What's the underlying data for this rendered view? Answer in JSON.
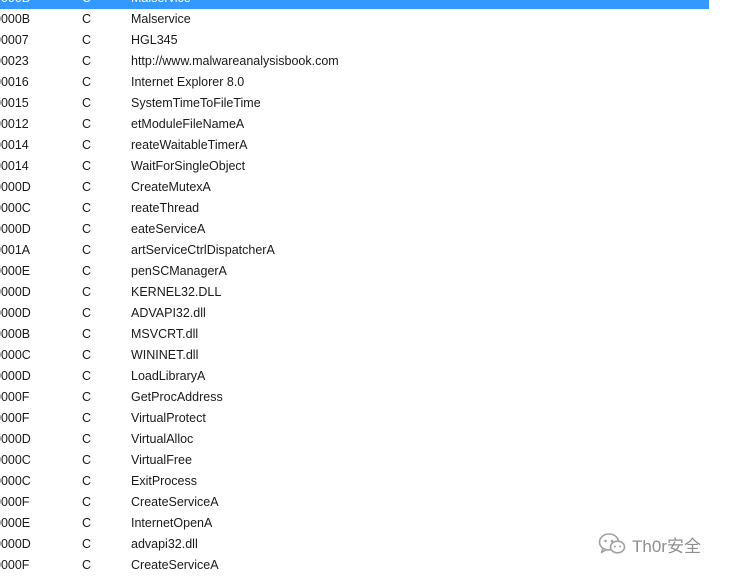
{
  "strings_view": {
    "rows": [
      {
        "length": "0000B",
        "type": "C",
        "string": "Malservice",
        "selected": true
      },
      {
        "length": "0000B",
        "type": "C",
        "string": "Malservice"
      },
      {
        "length": "00007",
        "type": "C",
        "string": "HGL345"
      },
      {
        "length": "00023",
        "type": "C",
        "string": "http://www.malwareanalysisbook.com"
      },
      {
        "length": "00016",
        "type": "C",
        "string": "Internet Explorer 8.0"
      },
      {
        "length": "00015",
        "type": "C",
        "string": "SystemTimeToFileTime"
      },
      {
        "length": "00012",
        "type": "C",
        "string": "etModuleFileNameA"
      },
      {
        "length": "00014",
        "type": "C",
        "string": "reateWaitableTimerA"
      },
      {
        "length": "00014",
        "type": "C",
        "string": "WaitForSingleObject"
      },
      {
        "length": "0000D",
        "type": "C",
        "string": "CreateMutexA"
      },
      {
        "length": "0000C",
        "type": "C",
        "string": "reateThread"
      },
      {
        "length": "0000D",
        "type": "C",
        "string": "eateServiceA"
      },
      {
        "length": "0001A",
        "type": "C",
        "string": "artServiceCtrlDispatcherA"
      },
      {
        "length": "0000E",
        "type": "C",
        "string": "penSCManagerA"
      },
      {
        "length": "0000D",
        "type": "C",
        "string": "KERNEL32.DLL"
      },
      {
        "length": "0000D",
        "type": "C",
        "string": "ADVAPI32.dll"
      },
      {
        "length": "0000B",
        "type": "C",
        "string": "MSVCRT.dll"
      },
      {
        "length": "0000C",
        "type": "C",
        "string": "WININET.dll"
      },
      {
        "length": "0000D",
        "type": "C",
        "string": "LoadLibraryA"
      },
      {
        "length": "0000F",
        "type": "C",
        "string": "GetProcAddress"
      },
      {
        "length": "0000F",
        "type": "C",
        "string": "VirtualProtect"
      },
      {
        "length": "0000D",
        "type": "C",
        "string": "VirtualAlloc"
      },
      {
        "length": "0000C",
        "type": "C",
        "string": "VirtualFree"
      },
      {
        "length": "0000C",
        "type": "C",
        "string": "ExitProcess"
      },
      {
        "length": "0000F",
        "type": "C",
        "string": "CreateServiceA"
      },
      {
        "length": "0000E",
        "type": "C",
        "string": "InternetOpenA"
      },
      {
        "length": "0000D",
        "type": "C",
        "string": "advapi32.dll"
      },
      {
        "length": "0000F",
        "type": "C",
        "string": "CreateServiceA"
      }
    ]
  },
  "watermark": {
    "text": "Th0r安全",
    "icon": "wechat-icon"
  },
  "colors": {
    "selection": "#3399ff",
    "text": "#1a1a1a"
  }
}
